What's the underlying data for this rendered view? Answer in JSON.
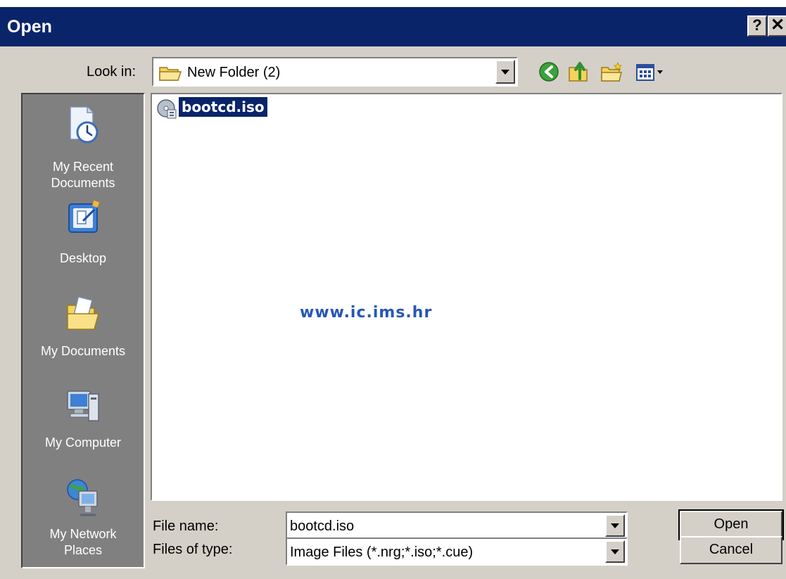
{
  "window": {
    "title": "Open",
    "help_label": "?",
    "close_label": "✕"
  },
  "look_in": {
    "label": "Look in:",
    "value": "New Folder (2)"
  },
  "toolbar": {
    "back": "back-icon",
    "up": "up-folder-icon",
    "new_folder": "new-folder-icon",
    "views": "views-menu-icon"
  },
  "places": [
    {
      "label": "My Recent Documents",
      "lines": [
        "My Recent",
        "Documents"
      ],
      "icon": "recent-documents-icon"
    },
    {
      "label": "Desktop",
      "lines": [
        "Desktop"
      ],
      "icon": "desktop-icon"
    },
    {
      "label": "My Documents",
      "lines": [
        "My Documents"
      ],
      "icon": "my-documents-icon"
    },
    {
      "label": "My Computer",
      "lines": [
        "My Computer"
      ],
      "icon": "my-computer-icon"
    },
    {
      "label": "My Network Places",
      "lines": [
        "My Network",
        "Places"
      ],
      "icon": "network-places-icon"
    }
  ],
  "files": [
    {
      "name": "bootcd.iso",
      "selected": true,
      "icon": "disc-image-icon"
    }
  ],
  "watermark": "www.ic.ims.hr",
  "file_name": {
    "label": "File name:",
    "value": "bootcd.iso"
  },
  "file_type": {
    "label": "Files of type:",
    "value": "Image Files (*.nrg;*.iso;*.cue)"
  },
  "buttons": {
    "open": "Open",
    "cancel": "Cancel"
  },
  "colors": {
    "titlebar": "#0a246a",
    "dialog_face": "#d4d0c8",
    "places_bar": "#808080",
    "selection": "#0a246a",
    "watermark": "#2657b5"
  }
}
